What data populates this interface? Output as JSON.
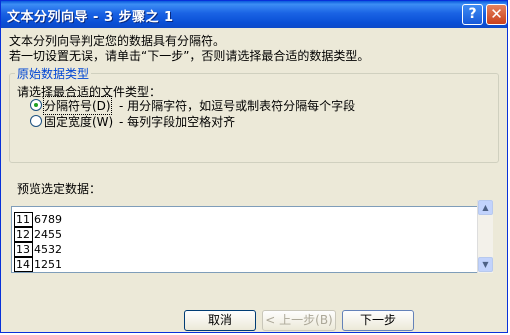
{
  "window": {
    "title": "文本分列向导 - 3 步骤之 1",
    "help_button": "?",
    "close_button": "✕"
  },
  "intro": {
    "line1": "文本分列向导判定您的数据具有分隔符。",
    "line2": "若一切设置无误，请单击“下一步”，否则请选择最合适的数据类型。"
  },
  "group": {
    "legend": "原始数据类型",
    "prompt": "请选择最合适的文件类型：",
    "options": [
      {
        "label": "分隔符号(D)",
        "desc": "- 用分隔字符，如逗号或制表符分隔每个字段",
        "selected": true
      },
      {
        "label": "固定宽度(W)",
        "desc": "- 每列字段加空格对齐",
        "selected": false
      }
    ]
  },
  "preview": {
    "label": "预览选定数据：",
    "rows": [
      {
        "num": "11",
        "value": "6789"
      },
      {
        "num": "12",
        "value": "2455"
      },
      {
        "num": "13",
        "value": "4532"
      },
      {
        "num": "14",
        "value": "1251"
      }
    ]
  },
  "buttons": {
    "cancel": "取消",
    "back": "< 上一步(B)",
    "next": "下一步"
  }
}
